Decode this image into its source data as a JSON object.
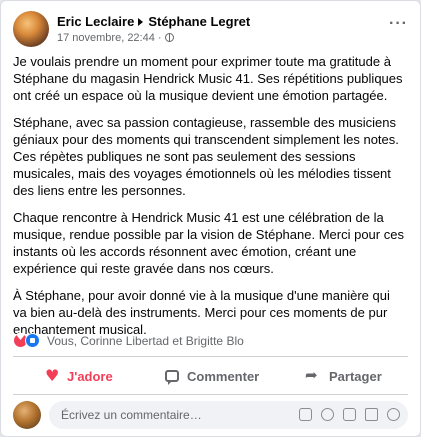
{
  "post": {
    "author": "Eric Leclaire",
    "target": "Stéphane Legret",
    "timestamp": "17 novembre, 22:44",
    "dot": "·",
    "more_label": "···",
    "paragraphs": [
      "Je voulais prendre un moment pour exprimer toute ma gratitude à Stéphane du magasin Hendrick Music 41. Ses répétitions publiques ont créé un espace où la musique devient une émotion partagée.",
      "Stéphane, avec sa passion contagieuse, rassemble des musiciens géniaux pour des moments qui transcendent simplement les notes. Ces répètes publiques ne sont pas seulement des sessions musicales, mais des voyages émotionnels où les mélodies tissent des liens entre les personnes.",
      "Chaque rencontre à Hendrick Music 41 est une célébration de la musique, rendue possible par la vision de Stéphane. Merci pour ces instants où les accords résonnent avec émotion, créant une expérience qui reste gravée dans nos cœurs.",
      "À Stéphane, pour avoir donné vie à la musique d'une manière qui va bien au-delà des instruments. Merci pour ces moments de pur enchantement musical."
    ]
  },
  "reactions": {
    "text": "Vous, Corinne Libertad et Brigitte Blo",
    "icons": [
      "love-reaction-icon",
      "like-reaction-icon"
    ]
  },
  "actions": {
    "love_label": "J'adore",
    "comment_label": "Commenter",
    "share_label": "Partager"
  },
  "composer": {
    "placeholder": "Écrivez un commentaire…",
    "tools": [
      "avatar-sticker-icon",
      "emoji-icon",
      "camera-icon",
      "gif-icon",
      "sticker-icon"
    ]
  },
  "colors": {
    "love": "#f33e58",
    "like": "#1877f2",
    "muted": "#65676b"
  }
}
